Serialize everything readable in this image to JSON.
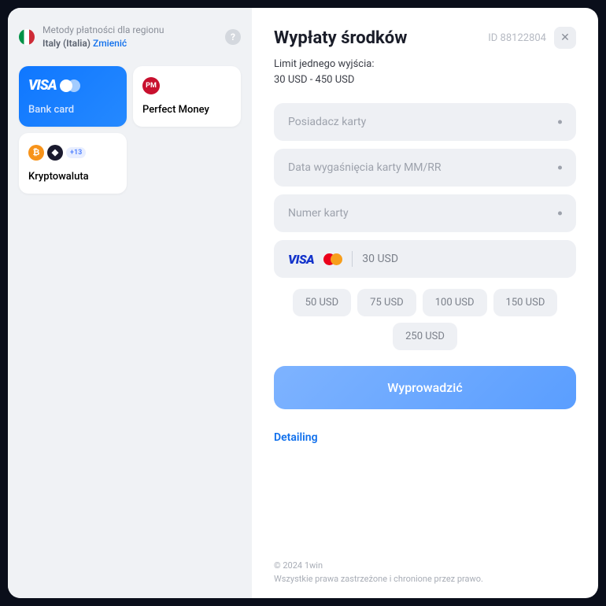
{
  "sidebar": {
    "region_label": "Metody płatności dla regionu",
    "region_name": "Italy (Italia)",
    "change_label": "Zmienić",
    "help": "?",
    "methods": [
      {
        "label": "Bank card"
      },
      {
        "label": "Perfect Money",
        "pm": "PM"
      },
      {
        "label": "Kryptowaluta",
        "btc": "₿",
        "eth": "◆",
        "badge": "+13"
      }
    ]
  },
  "main": {
    "title": "Wypłaty środków",
    "id": "ID 88122804",
    "close": "✕",
    "limit_label": "Limit jednego wyjścia:",
    "limit_value": "30 USD - 450 USD",
    "fields": {
      "holder": "Posiadacz karty",
      "expiry": "Data wygaśnięcia karty MM/RR",
      "number": "Numer karty"
    },
    "amount": {
      "visa": "VISA",
      "current": "30 USD"
    },
    "chips": [
      "50 USD",
      "75 USD",
      "100 USD",
      "150 USD",
      "250 USD"
    ],
    "submit": "Wyprowadzić",
    "detailing": "Detailing",
    "footer_line1": "© 2024 1win",
    "footer_line2": "Wszystkie prawa zastrzeżone i chronione przez prawo."
  }
}
